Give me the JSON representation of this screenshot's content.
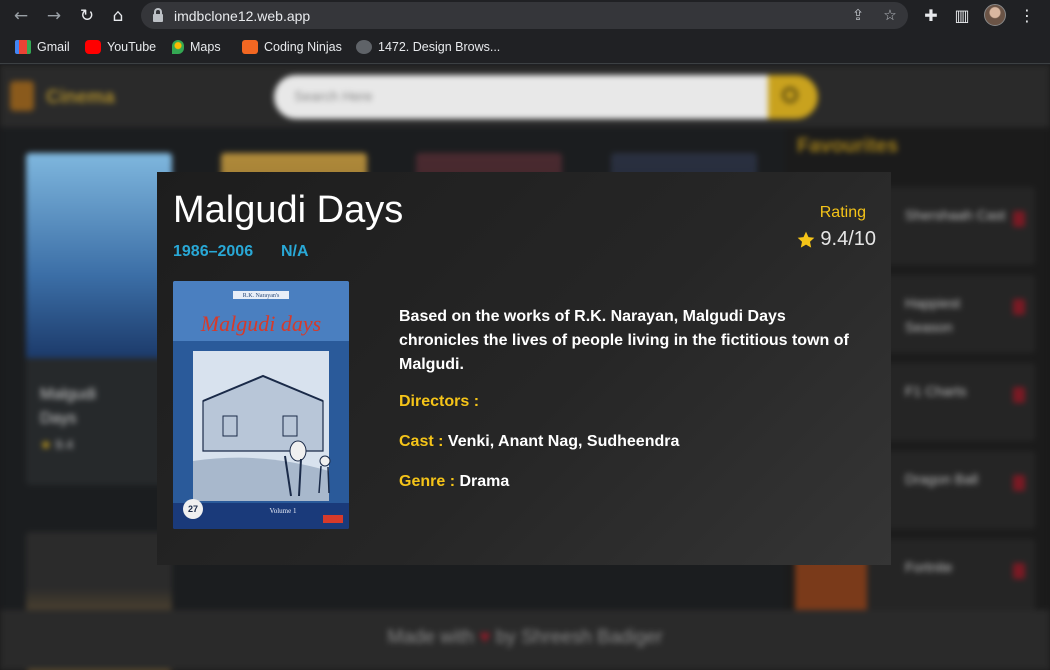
{
  "browser": {
    "url": "imdbclone12.web.app",
    "bookmarks": [
      {
        "label": "Gmail",
        "icon": "gmail-icon",
        "color": "#ea4335"
      },
      {
        "label": "YouTube",
        "icon": "youtube-icon",
        "color": "#ff0000"
      },
      {
        "label": "Maps",
        "icon": "maps-icon",
        "color": "#34a853"
      },
      {
        "label": "Coding Ninjas",
        "icon": "coding-ninjas-icon",
        "color": "#f26722"
      },
      {
        "label": "1472. Design Brows...",
        "icon": "leetcode-icon",
        "color": "#5f6368"
      }
    ]
  },
  "site": {
    "logo_text": "Cinema",
    "search_placeholder": "Search Here",
    "favourites_title": "Favourites",
    "favourites": [
      {
        "title": "Shershaah Cast"
      },
      {
        "title": "Happiest Season"
      },
      {
        "title": "F1 Charts"
      },
      {
        "title": "Dragon Ball"
      },
      {
        "title": "Fortnite"
      }
    ],
    "cards": [
      {
        "title": "Malgudi Days",
        "rating": "9.4"
      }
    ],
    "footer": {
      "prefix": "Made with",
      "suffix": "by Shreesh Badiger"
    }
  },
  "modal": {
    "title": "Malgudi Days",
    "years": "1986–2006",
    "rated": "N/A",
    "rating_label": "Rating",
    "rating_value": "9.4/10",
    "plot": "Based on the works of R.K. Narayan, Malgudi Days chronicles the lives of people living in the fictitious town of Malgudi.",
    "directors_label": "Directors :",
    "directors": "",
    "cast_label": "Cast :",
    "cast": "Venki, Anant Nag, Sudheendra",
    "genre_label": "Genre :",
    "genre": "Drama",
    "poster": {
      "top_text": "Malgudi days",
      "author": "R.K. Narayan's",
      "volume": "Volume 1",
      "episodes": "27"
    }
  },
  "colors": {
    "accent_yellow": "#f5c418",
    "accent_blue": "#29a8d6"
  }
}
